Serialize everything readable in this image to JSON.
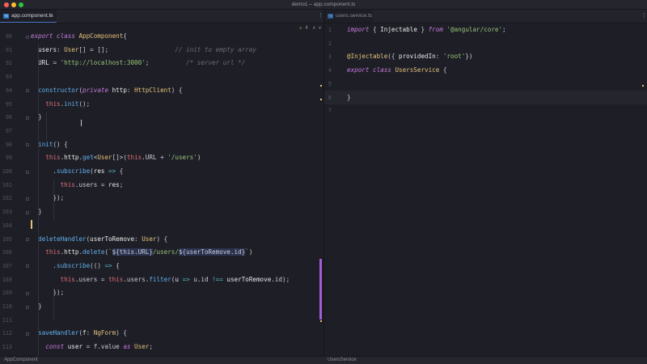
{
  "window": {
    "title": "demo1 – app.component.ts"
  },
  "left_tab": {
    "label": "app.component.ts",
    "icon": "typescript-file-icon",
    "close": "✕"
  },
  "right_tab": {
    "label": "users.service.ts",
    "icon": "typescript-file-icon",
    "close": "✕"
  },
  "left_toolbar": {
    "more": "⋮",
    "warning": "⚠",
    "warning_count": "4",
    "up": "∧",
    "down": "∨"
  },
  "right_toolbar": {
    "more": "⋮"
  },
  "left_editor": {
    "line_numbers": [
      "90",
      "91",
      "92",
      "93",
      "94",
      "95",
      "96",
      "97",
      "98",
      "99",
      "100",
      "101",
      "102",
      "103",
      "104",
      "105",
      "106",
      "107",
      "108",
      "109",
      "110",
      "111",
      "112",
      "113"
    ],
    "lines": [
      [
        [
          "kw",
          "export "
        ],
        [
          "kw",
          "class "
        ],
        [
          "cls",
          "AppComponent"
        ],
        [
          "",
          "{"
        ]
      ],
      [
        [
          "",
          "  "
        ],
        [
          "prop",
          "users"
        ],
        [
          "",
          ": "
        ],
        [
          "cls",
          "User"
        ],
        [
          "",
          "[] = [];"
        ],
        [
          "",
          "                  "
        ],
        [
          "com",
          "// init to empty array"
        ]
      ],
      [
        [
          "",
          "  "
        ],
        [
          "prop",
          "URL"
        ],
        [
          "",
          " = "
        ],
        [
          "str",
          "'http://localhost:3000'"
        ],
        [
          "",
          ";"
        ],
        [
          "",
          "          "
        ],
        [
          "com",
          "/* server url */"
        ]
      ],
      [],
      [
        [
          "",
          "  "
        ],
        [
          "fn",
          "constructor"
        ],
        [
          "",
          "("
        ],
        [
          "kw",
          "private "
        ],
        [
          "prop",
          "http"
        ],
        [
          "",
          ": "
        ],
        [
          "cls",
          "HttpClient"
        ],
        [
          "",
          ") {"
        ]
      ],
      [
        [
          "",
          "    "
        ],
        [
          "this",
          "this"
        ],
        [
          "",
          "."
        ],
        [
          "fn",
          "init"
        ],
        [
          "",
          "();"
        ]
      ],
      [
        [
          "",
          "  "
        ],
        [
          "",
          "}"
        ]
      ],
      [],
      [
        [
          "",
          "  "
        ],
        [
          "fn",
          "init"
        ],
        [
          "",
          "() {"
        ]
      ],
      [
        [
          "",
          "    "
        ],
        [
          "this",
          "this"
        ],
        [
          "",
          "."
        ],
        [
          "prop",
          "http"
        ],
        [
          "",
          "."
        ],
        [
          "fn",
          "get"
        ],
        [
          "",
          "<"
        ],
        [
          "cls",
          "User"
        ],
        [
          "",
          "[]>("
        ],
        [
          "this",
          "this"
        ],
        [
          "",
          ".URL + "
        ],
        [
          "str",
          "'/users'"
        ],
        [
          "",
          ")"
        ]
      ],
      [
        [
          "",
          "      ."
        ],
        [
          "fn",
          "subscribe"
        ],
        [
          "",
          "("
        ],
        [
          "prop",
          "res"
        ],
        [
          "",
          " "
        ],
        [
          "op",
          "=>"
        ],
        [
          "",
          " {"
        ]
      ],
      [
        [
          "",
          "        "
        ],
        [
          "this",
          "this"
        ],
        [
          "",
          ".users = "
        ],
        [
          "prop",
          "res"
        ],
        [
          "",
          ";"
        ]
      ],
      [
        [
          "",
          "      "
        ],
        [
          "",
          "});"
        ]
      ],
      [
        [
          "",
          "  "
        ],
        [
          "",
          "}"
        ]
      ],
      [],
      [
        [
          "",
          "  "
        ],
        [
          "fn",
          "deleteHandler"
        ],
        [
          "",
          "("
        ],
        [
          "prop",
          "userToRemove"
        ],
        [
          "",
          ": "
        ],
        [
          "cls",
          "User"
        ],
        [
          "",
          ") {"
        ]
      ],
      [
        [
          "",
          "    "
        ],
        [
          "this",
          "this"
        ],
        [
          "",
          "."
        ],
        [
          "prop",
          "http"
        ],
        [
          "",
          "."
        ],
        [
          "fn",
          "delete"
        ],
        [
          "",
          "("
        ],
        [
          "str",
          "`"
        ],
        [
          "tpl",
          "${this.URL}"
        ],
        [
          "str",
          "/users/"
        ],
        [
          "tpl",
          "${userToRemove.id}"
        ],
        [
          "str",
          "`"
        ],
        [
          "",
          ")"
        ]
      ],
      [
        [
          "",
          "      ."
        ],
        [
          "fn",
          "subscribe"
        ],
        [
          "",
          "(() "
        ],
        [
          "op",
          "=>"
        ],
        [
          "",
          " {"
        ]
      ],
      [
        [
          "",
          "        "
        ],
        [
          "this",
          "this"
        ],
        [
          "",
          ".users = "
        ],
        [
          "this",
          "this"
        ],
        [
          "",
          ".users."
        ],
        [
          "fn",
          "filter"
        ],
        [
          "",
          "("
        ],
        [
          "prop",
          "u"
        ],
        [
          "",
          " "
        ],
        [
          "op",
          "=>"
        ],
        [
          "",
          " u.id "
        ],
        [
          "op",
          "!=="
        ],
        [
          "",
          " "
        ],
        [
          "prop",
          "userToRemove"
        ],
        [
          "",
          ".id);"
        ]
      ],
      [
        [
          "",
          "      "
        ],
        [
          "",
          "});"
        ]
      ],
      [
        [
          "",
          "  "
        ],
        [
          "",
          "}"
        ]
      ],
      [],
      [
        [
          "",
          "  "
        ],
        [
          "fn",
          "saveHandler"
        ],
        [
          "",
          "("
        ],
        [
          "prop",
          "f"
        ],
        [
          "",
          ": "
        ],
        [
          "cls",
          "NgForm"
        ],
        [
          "",
          ") {"
        ]
      ],
      [
        [
          "",
          "    "
        ],
        [
          "kw",
          "const "
        ],
        [
          "prop",
          "user"
        ],
        [
          "",
          " = f.value "
        ],
        [
          "kw",
          "as "
        ],
        [
          "cls",
          "User"
        ],
        [
          "",
          ";"
        ]
      ]
    ]
  },
  "right_editor": {
    "line_numbers": [
      "1",
      "2",
      "3",
      "4",
      "5",
      "6",
      "7"
    ],
    "lines": [
      [
        [
          "kw",
          "import "
        ],
        [
          "",
          "{ "
        ],
        [
          "prop",
          "Injectable"
        ],
        [
          "",
          " } "
        ],
        [
          "kw",
          "from "
        ],
        [
          "str",
          "'@angular/core'"
        ],
        [
          "",
          ";"
        ]
      ],
      [],
      [
        [
          "cls",
          "@Injectable"
        ],
        [
          "",
          "({ "
        ],
        [
          "prop",
          "providedIn"
        ],
        [
          "",
          ": "
        ],
        [
          "str",
          "'root'"
        ],
        [
          "",
          "})"
        ]
      ],
      [
        [
          "kw",
          "export "
        ],
        [
          "kw",
          "class "
        ],
        [
          "cls",
          "UsersService"
        ],
        [
          "",
          " {"
        ]
      ],
      [],
      [
        [
          "",
          "}"
        ]
      ],
      []
    ]
  },
  "status": {
    "left": "AppComponent",
    "right": "UsersService"
  },
  "colors": {
    "accent": "#a35bd8",
    "background": "#1e1f26",
    "caret": "#e5c07b"
  }
}
